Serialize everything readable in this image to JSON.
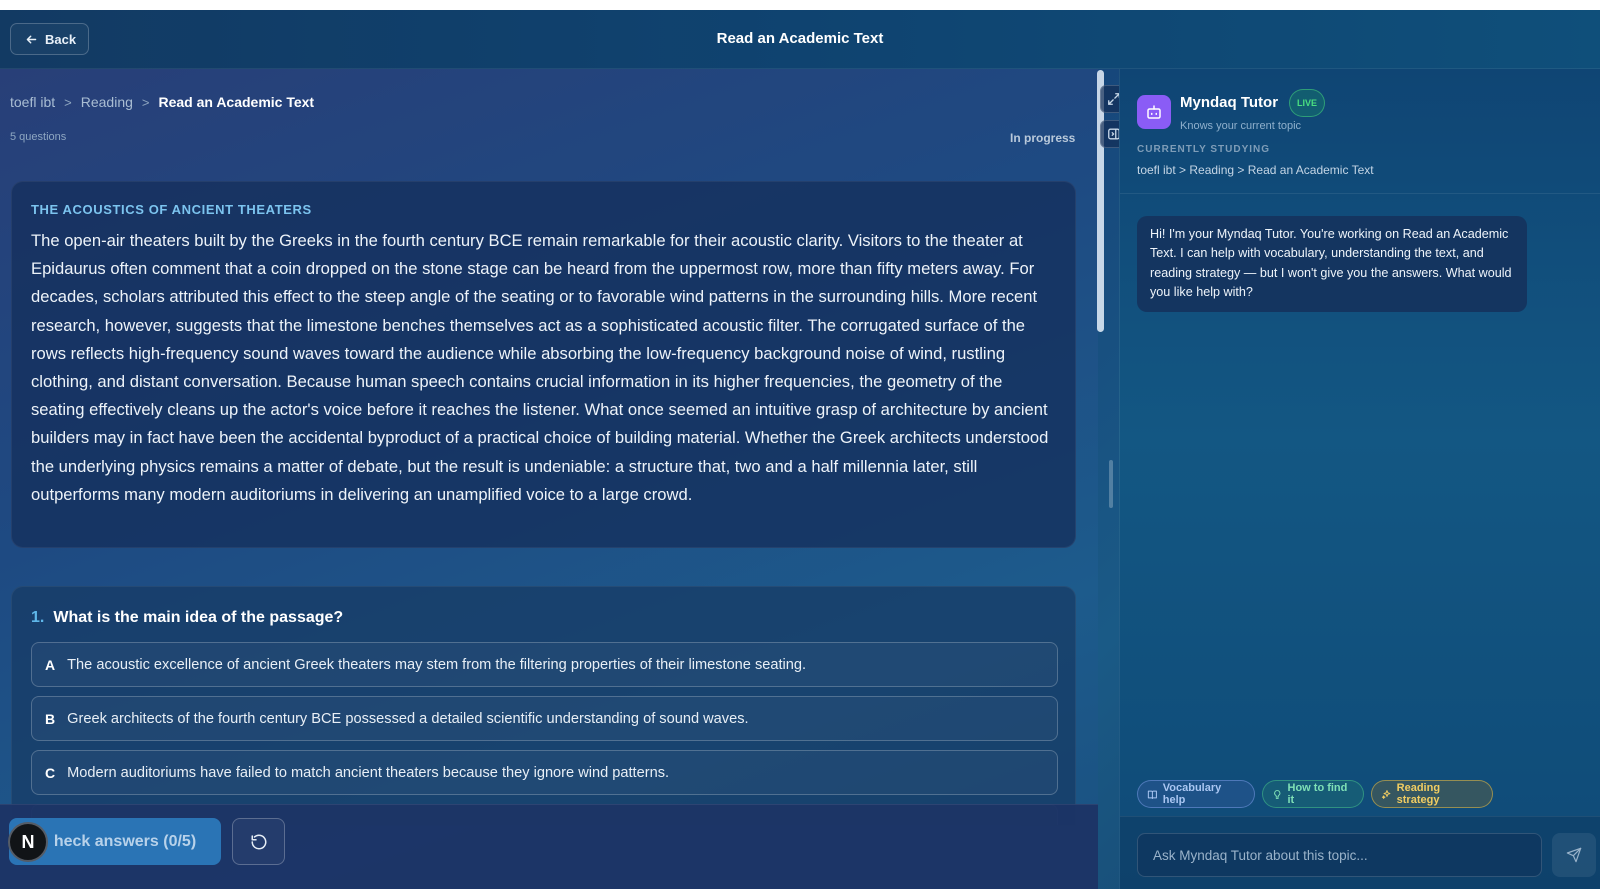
{
  "header": {
    "back_label": "Back",
    "title": "Read an Academic Text"
  },
  "breadcrumb": {
    "items": [
      "toefl ibt",
      "Reading",
      "Read an Academic Text"
    ],
    "separator": ">"
  },
  "meta": {
    "question_count": "5 questions",
    "status": "In progress"
  },
  "passage": {
    "heading": "THE ACOUSTICS OF ANCIENT THEATERS",
    "body": "The open-air theaters built by the Greeks in the fourth century BCE remain remarkable for their acoustic clarity. Visitors to the theater at Epidaurus often comment that a coin dropped on the stone stage can be heard from the uppermost row, more than fifty meters away. For decades, scholars attributed this effect to the steep angle of the seating or to favorable wind patterns in the surrounding hills. More recent research, however, suggests that the limestone benches themselves act as a sophisticated acoustic filter. The corrugated surface of the rows reflects high-frequency sound waves toward the audience while absorbing the low-frequency background noise of wind, rustling clothing, and distant conversation. Because human speech contains crucial information in its higher frequencies, the geometry of the seating effectively cleans up the actor's voice before it reaches the listener. What once seemed an intuitive grasp of architecture by ancient builders may in fact have been the accidental byproduct of a practical choice of building material. Whether the Greek architects understood the underlying physics remains a matter of debate, but the result is undeniable: a structure that, two and a half millennia later, still outperforms many modern auditoriums in delivering an unamplified voice to a large crowd."
  },
  "question": {
    "number": "1.",
    "text": "What is the main idea of the passage?",
    "options": [
      {
        "letter": "A",
        "text": "The acoustic excellence of ancient Greek theaters may stem from the filtering properties of their limestone seating."
      },
      {
        "letter": "B",
        "text": "Greek architects of the fourth century BCE possessed a detailed scientific understanding of sound waves."
      },
      {
        "letter": "C",
        "text": "Modern auditoriums have failed to match ancient theaters because they ignore wind patterns."
      }
    ]
  },
  "footer": {
    "check_label": "heck answers (0/5)",
    "avatar_letter": "N"
  },
  "tutor": {
    "name": "Myndaq Tutor",
    "live_badge": "LIVE",
    "subtitle": "Knows your current topic",
    "studying_label": "CURRENTLY STUDYING",
    "studying_path": "toefl ibt > Reading > Read an Academic Text",
    "greeting": "Hi! I'm your Myndaq Tutor. You're working on Read an Academic Text. I can help with vocabulary, understanding the text, and reading strategy — but I won't give you the answers. What would you like help with?",
    "chips": {
      "vocab": "Vocabulary help",
      "find": "How to find it",
      "strategy": "Reading strategy"
    },
    "input_placeholder": "Ask Myndaq Tutor about this topic..."
  },
  "icons": {
    "back": "arrow-left-icon",
    "expand": "expand-icon",
    "panel": "side-panel-icon",
    "reset": "rotate-ccw-icon",
    "bot": "bot-icon",
    "book": "book-icon",
    "bulb": "lightbulb-icon",
    "sparkle": "sparkles-icon",
    "send": "send-icon"
  },
  "colors": {
    "accent": "#5fb7ea",
    "heading": "#7cc4ef",
    "tutor_avatar": "#8a5cf6",
    "live": "#4ade80",
    "check_button": "#2a74b5"
  }
}
